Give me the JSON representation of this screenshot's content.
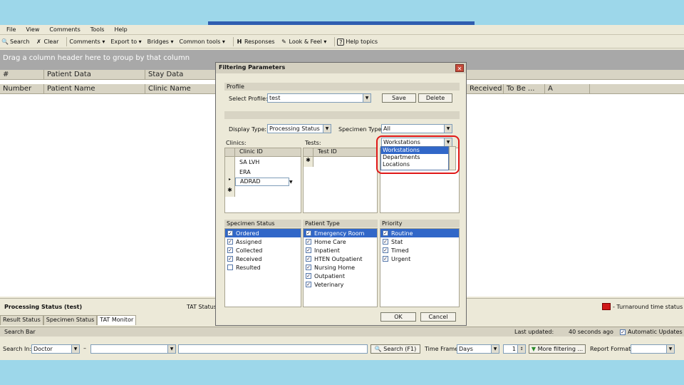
{
  "menu": [
    "File",
    "View",
    "Comments",
    "Tools",
    "Help"
  ],
  "toolbar": {
    "search": "Search",
    "clear": "Clear",
    "comments": "Comments",
    "export": "Export to",
    "bridges": "Bridges",
    "common_tools": "Common tools",
    "responses": "Responses",
    "look_feel": "Look & Feel",
    "help_topics": "Help topics"
  },
  "group_hint": "Drag a column header here to group by that column",
  "grid": {
    "header_top": [
      "#",
      "Patient Data",
      "Stay Data"
    ],
    "header_bottom": [
      "Number",
      "Patient Name",
      "Clinic Name"
    ],
    "header_bottom_right": [
      "Received",
      "To Be ...",
      "A"
    ]
  },
  "dialog": {
    "title": "Filtering Parameters",
    "profile_section": "Profile",
    "select_profile_label": "Select Profile:",
    "select_profile_value": "test",
    "save_btn": "Save",
    "delete_btn": "Delete",
    "display_type_label": "Display Type:",
    "display_type_value": "Processing Status",
    "specimen_type_label": "Specimen Type:",
    "specimen_type_value": "All",
    "clinics_label": "Clinics:",
    "tests_label": "Tests:",
    "workstation_value": "Workstations",
    "clinic_col": "Clinic ID",
    "test_col": "Test ID",
    "clinics": [
      "SA LVH",
      "ERA",
      "ADRAD"
    ],
    "dropdown_options": [
      "Workstations",
      "Departments",
      "Locations"
    ],
    "specimen_status_head": "Specimen Status",
    "specimen_status": [
      {
        "label": "Ordered",
        "checked": true
      },
      {
        "label": "Assigned",
        "checked": true
      },
      {
        "label": "Collected",
        "checked": true
      },
      {
        "label": "Received",
        "checked": true
      },
      {
        "label": "Resulted",
        "checked": false
      }
    ],
    "patient_type_head": "Patient Type",
    "patient_type": [
      {
        "label": "Emergency Room",
        "checked": true
      },
      {
        "label": "Home Care",
        "checked": true
      },
      {
        "label": "Inpatient",
        "checked": true
      },
      {
        "label": "HTEN Outpatient",
        "checked": true
      },
      {
        "label": "Nursing Home",
        "checked": true
      },
      {
        "label": "Outpatient",
        "checked": true
      },
      {
        "label": "Veterinary",
        "checked": true
      }
    ],
    "priority_head": "Priority",
    "priority": [
      {
        "label": "Routine",
        "checked": true
      },
      {
        "label": "Stat",
        "checked": true
      },
      {
        "label": "Timed",
        "checked": true
      },
      {
        "label": "Urgent",
        "checked": true
      }
    ],
    "ok_btn": "OK",
    "cancel_btn": "Cancel"
  },
  "status": {
    "title": "Processing Status (test)",
    "tat_label": "TAT Status",
    "turnaround_label": "- Turnaround time status"
  },
  "tabs": [
    "Result Status",
    "Specimen Status",
    "TAT Monitor"
  ],
  "searchbar": {
    "label": "Search Bar",
    "last_updated_label": "Last updated:",
    "last_updated_value": "40 seconds ago",
    "auto_update": "Automatic Updates"
  },
  "bottom": {
    "search_in_label": "Search In:",
    "search_in_value": "Doctor",
    "dash": "–",
    "search_btn": "Search (F1)",
    "time_frame_label": "Time Frame:",
    "time_frame_value": "Days",
    "time_frame_num": "1",
    "more_filtering": "More filtering ...",
    "report_format_label": "Report Format:"
  },
  "colors": {
    "accent": "#3167c8",
    "highlight": "#e01818",
    "background": "#9dd7ea"
  }
}
